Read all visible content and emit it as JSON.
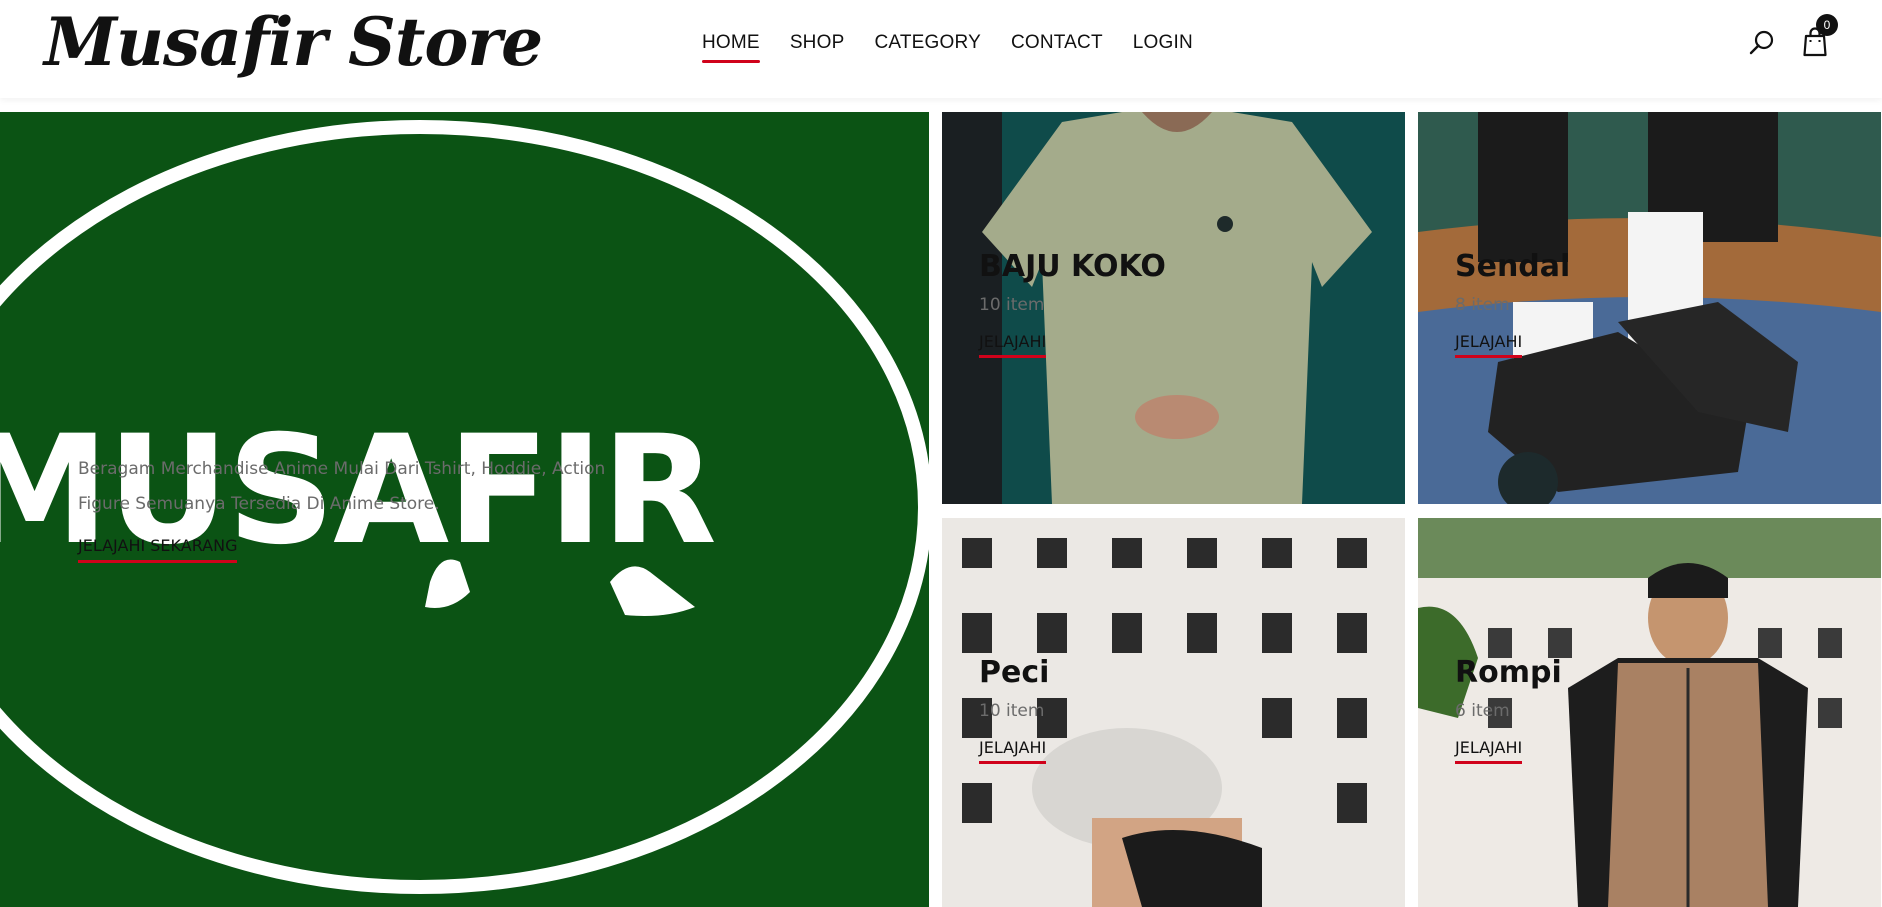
{
  "header": {
    "logo_text": "Musafir Store",
    "nav": [
      {
        "label": "HOME",
        "active": true
      },
      {
        "label": "SHOP",
        "active": false
      },
      {
        "label": "CATEGORY",
        "active": false
      },
      {
        "label": "CONTACT",
        "active": false
      },
      {
        "label": "LOGIN",
        "active": false
      }
    ],
    "search_icon": "search-icon",
    "cart_icon": "shopping-bag-icon",
    "cart_count": "0"
  },
  "hero": {
    "image_text": "MUSAFIR",
    "description": "Beragam Merchandise Anime Mulai Dari Tshirt, Hoddie, Action Figure Semuanya Tersedia Di Anime Store.",
    "cta_label": "JELAJAHI SEKARANG"
  },
  "categories": [
    {
      "name": "BAJU KOKO",
      "count": "10 item",
      "link_label": "JELAJAHI"
    },
    {
      "name": "Sendal",
      "count": "8 item",
      "link_label": "JELAJAHI"
    },
    {
      "name": "Peci",
      "count": "10 item",
      "link_label": "JELAJAHI"
    },
    {
      "name": "Rompi",
      "count": "6 item",
      "link_label": "JELAJAHI"
    }
  ],
  "colors": {
    "accent": "#d0021b",
    "hero_green": "#0b5314",
    "text_dark": "#111111",
    "text_muted": "#6b6b6b"
  }
}
